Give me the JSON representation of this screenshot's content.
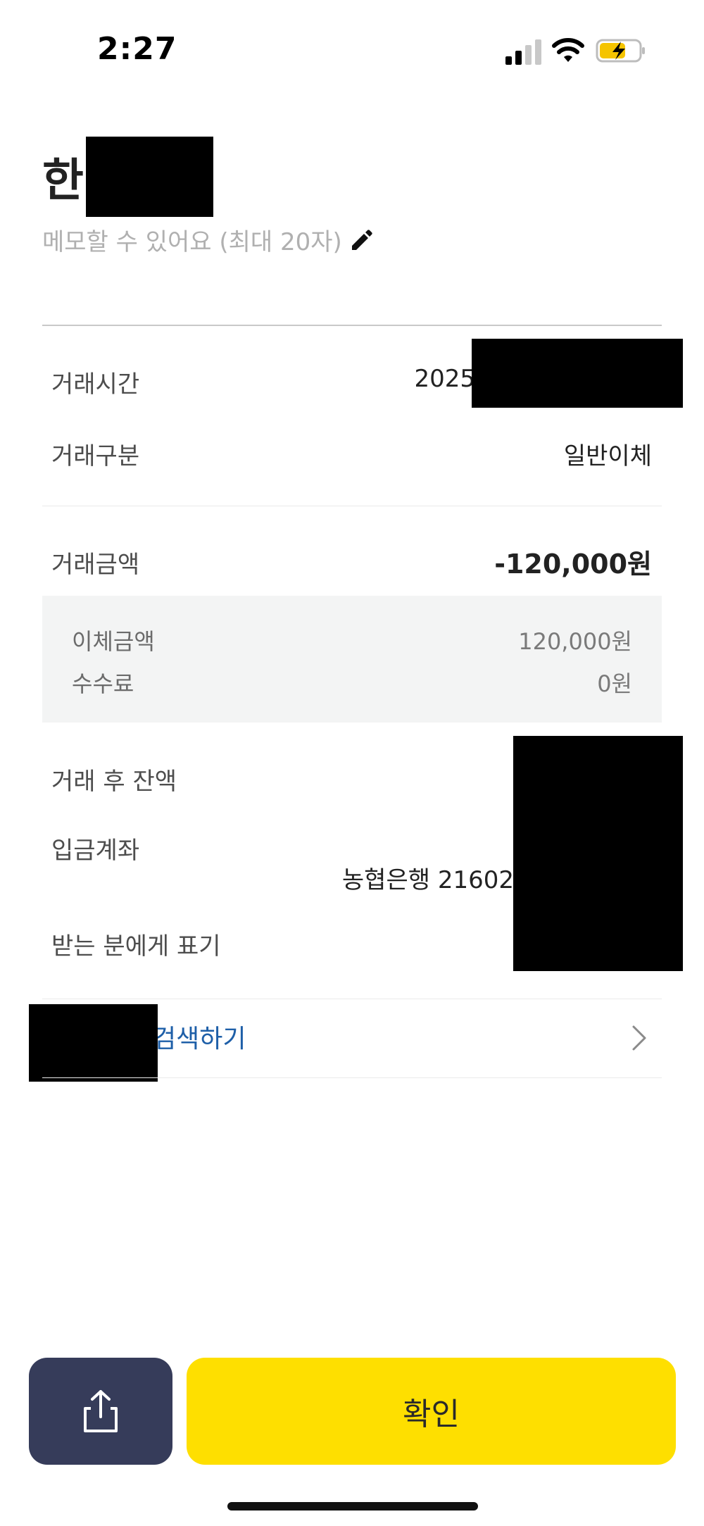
{
  "status_bar": {
    "time": "2:27"
  },
  "header": {
    "title": "한",
    "memo_placeholder": "메모할 수 있어요 (최대 20자)"
  },
  "details": {
    "time_label": "거래시간",
    "time_value": "2025",
    "type_label": "거래구분",
    "type_value": "일반이체",
    "amount_label": "거래금액",
    "amount_value": "-120,000원",
    "transfer_amount_label": "이체금액",
    "transfer_amount_value": "120,000원",
    "fee_label": "수수료",
    "fee_value": "0원",
    "balance_label": "거래 후 잔액",
    "deposit_account_label": "입금계좌",
    "deposit_account_value": "농협은행 21602",
    "recipient_display_label": "받는 분에게 표기"
  },
  "search": {
    "label": "검색하기"
  },
  "actions": {
    "confirm_label": "확인"
  },
  "colors": {
    "confirm": "#fedf00",
    "share": "#363c5a",
    "link": "#1e5fa8"
  }
}
